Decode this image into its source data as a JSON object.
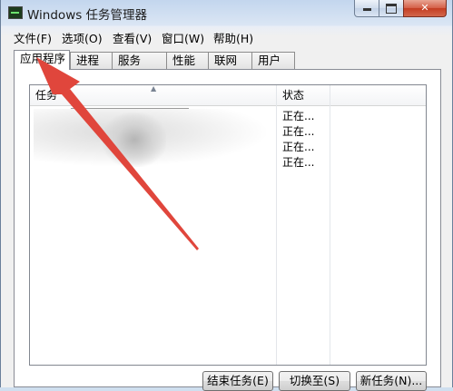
{
  "window": {
    "title": "Windows 任务管理器",
    "controls": {
      "minimize": "—",
      "maximize": "□",
      "close": "✕"
    }
  },
  "menu": {
    "items": [
      "文件(F)",
      "选项(O)",
      "查看(V)",
      "窗口(W)",
      "帮助(H)"
    ]
  },
  "tabs": [
    "应用程序",
    "进程",
    "服务",
    "性能",
    "联网",
    "用户"
  ],
  "active_tab": "应用程序",
  "table": {
    "columns": [
      "任务",
      "状态"
    ],
    "rows": [
      {
        "task": "",
        "status": "正在..."
      },
      {
        "task": "",
        "status": "正在..."
      },
      {
        "task": "",
        "status": "正在..."
      },
      {
        "task": "",
        "status": "正在..."
      }
    ]
  },
  "buttons": {
    "end_task": "结束任务(E)",
    "switch_to": "切换至(S)",
    "new_task": "新任务(N)..."
  },
  "annotation": {
    "color": "#e0463c",
    "icon": "red-arrow-icon"
  }
}
